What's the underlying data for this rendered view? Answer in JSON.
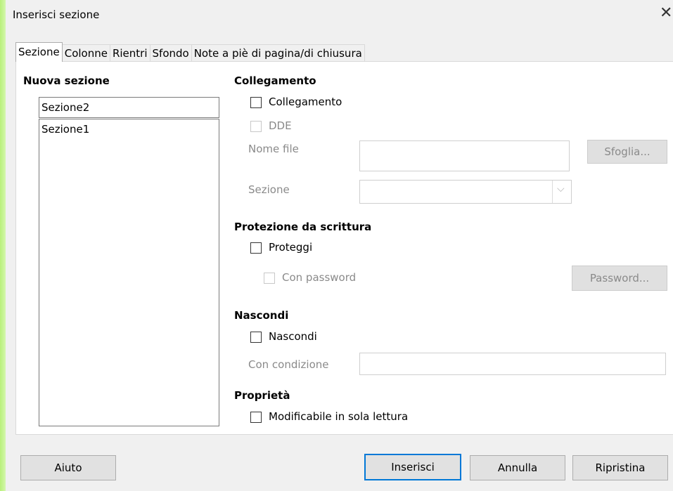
{
  "window": {
    "title": "Inserisci sezione",
    "close_icon": "close-icon"
  },
  "tabs": [
    {
      "label": "Sezione",
      "active": true
    },
    {
      "label": "Colonne",
      "active": false
    },
    {
      "label": "Rientri",
      "active": false
    },
    {
      "label": "Sfondo",
      "active": false
    },
    {
      "label": "Note a piè di pagina/di chiusura",
      "active": false
    }
  ],
  "new_section": {
    "heading": "Nuova sezione",
    "name_value": "Sezione2",
    "list_items": [
      "Sezione1"
    ]
  },
  "link": {
    "heading": "Collegamento",
    "link_checkbox": {
      "label": "Collegamento",
      "checked": false
    },
    "dde_checkbox": {
      "label": "DDE",
      "checked": false,
      "enabled": false
    },
    "file_name_label": "Nome file",
    "file_name_value": "",
    "browse_button": "Sfoglia...",
    "section_label": "Sezione",
    "section_value": ""
  },
  "write_protection": {
    "heading": "Protezione da scrittura",
    "protect_checkbox": {
      "label": "Proteggi",
      "checked": false
    },
    "password_checkbox": {
      "label": "Con password",
      "checked": false,
      "enabled": false
    },
    "password_button": "Password..."
  },
  "hide": {
    "heading": "Nascondi",
    "hide_checkbox": {
      "label": "Nascondi",
      "checked": false
    },
    "condition_label": "Con condizione",
    "condition_value": ""
  },
  "properties": {
    "heading": "Proprietà",
    "readonly_checkbox": {
      "label": "Modificabile in sola lettura",
      "checked": false
    }
  },
  "buttons": {
    "help": "Aiuto",
    "insert": "Inserisci",
    "cancel": "Annulla",
    "reset": "Ripristina"
  },
  "colors": {
    "accent": "#0078d7",
    "dialog_bg": "#f0f0f0",
    "disabled_text": "#8a8a8a"
  }
}
